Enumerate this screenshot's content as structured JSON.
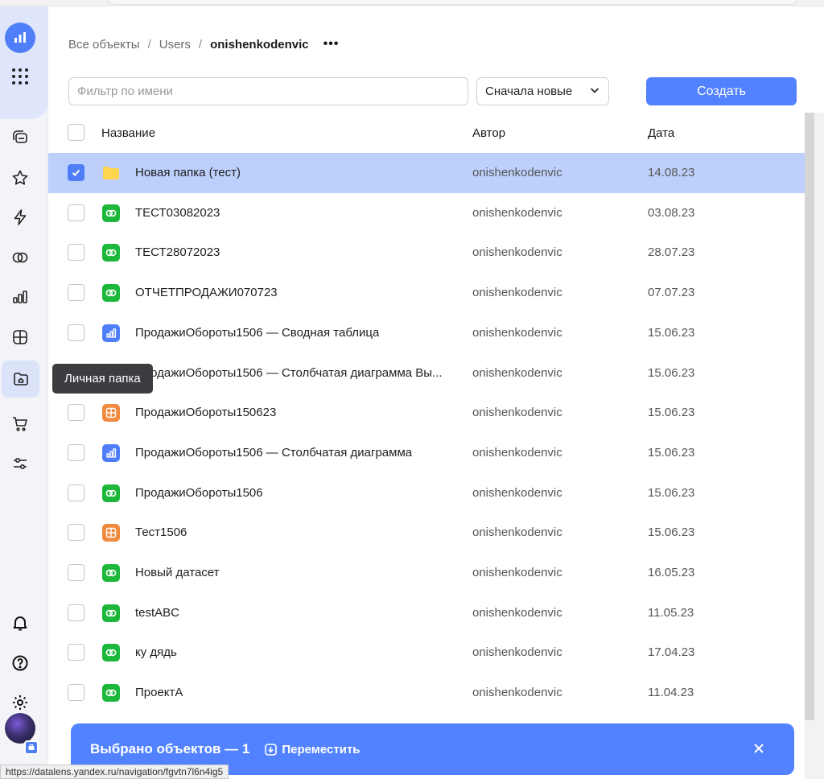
{
  "breadcrumb": {
    "root": "Все объекты",
    "sep1": "/",
    "middle": "Users",
    "sep2": "/",
    "current": "onishenkodenvic",
    "more": "•••"
  },
  "toolbar": {
    "filter_placeholder": "Фильтр по имени",
    "sort_label": "Сначала новые",
    "create_label": "Создать"
  },
  "table": {
    "headers": {
      "name": "Название",
      "author": "Автор",
      "date": "Дата"
    },
    "rows": [
      {
        "type": "folder",
        "name": "Новая папка (тест)",
        "author": "onishenkodenvic",
        "date": "14.08.23",
        "checked": true
      },
      {
        "type": "dataset",
        "name": "ТЕСТ03082023",
        "author": "onishenkodenvic",
        "date": "03.08.23",
        "checked": false
      },
      {
        "type": "dataset",
        "name": "ТЕСТ28072023",
        "author": "onishenkodenvic",
        "date": "28.07.23",
        "checked": false
      },
      {
        "type": "dataset",
        "name": "ОТЧЕТПРОДАЖИ070723",
        "author": "onishenkodenvic",
        "date": "07.07.23",
        "checked": false
      },
      {
        "type": "chart",
        "name": "ПродажиОбороты1506 — Сводная таблица",
        "author": "onishenkodenvic",
        "date": "15.06.23",
        "checked": false
      },
      {
        "type": "chart",
        "name": "ПродажиОбороты1506 — Столбчатая диаграмма Вы...",
        "author": "onishenkodenvic",
        "date": "15.06.23",
        "checked": false
      },
      {
        "type": "dashboard",
        "name": "ПродажиОбороты150623",
        "author": "onishenkodenvic",
        "date": "15.06.23",
        "checked": false
      },
      {
        "type": "chart",
        "name": "ПродажиОбороты1506 — Столбчатая диаграмма",
        "author": "onishenkodenvic",
        "date": "15.06.23",
        "checked": false
      },
      {
        "type": "dataset",
        "name": "ПродажиОбороты1506",
        "author": "onishenkodenvic",
        "date": "15.06.23",
        "checked": false
      },
      {
        "type": "dashboard",
        "name": "Тест1506",
        "author": "onishenkodenvic",
        "date": "15.06.23",
        "checked": false
      },
      {
        "type": "dataset",
        "name": "Новый датасет",
        "author": "onishenkodenvic",
        "date": "16.05.23",
        "checked": false
      },
      {
        "type": "dataset",
        "name": "testABC",
        "author": "onishenkodenvic",
        "date": "11.05.23",
        "checked": false
      },
      {
        "type": "dataset",
        "name": "ку дядь",
        "author": "onishenkodenvic",
        "date": "17.04.23",
        "checked": false
      },
      {
        "type": "dataset",
        "name": "ПроектА",
        "author": "onishenkodenvic",
        "date": "11.04.23",
        "checked": false
      }
    ]
  },
  "tooltip": {
    "text": "Личная папка"
  },
  "action_bar": {
    "selected_text": "Выбрано объектов — 1",
    "move_label": "Переместить",
    "close_icon": "close-icon"
  },
  "status_url": "https://datalens.yandex.ru/navigation/fgvtn7l6n4ig5",
  "colors": {
    "accent": "#5282ff",
    "selected_row": "#bdd0fc",
    "dataset_icon": "#1db83b",
    "chart_icon": "#4f7ef8",
    "dashboard_icon": "#f08a3e",
    "folder_icon": "#ffd54f"
  },
  "sidebar": {
    "items": [
      "logo-icon",
      "apps-icon",
      "collections-icon",
      "favorites-icon",
      "actions-icon",
      "datasets-icon",
      "charts-icon",
      "dashboards-icon",
      "personal-folder-icon",
      "marketplace-icon",
      "settings-sliders-icon",
      "notifications-icon",
      "help-icon",
      "gear-icon",
      "avatar"
    ]
  }
}
